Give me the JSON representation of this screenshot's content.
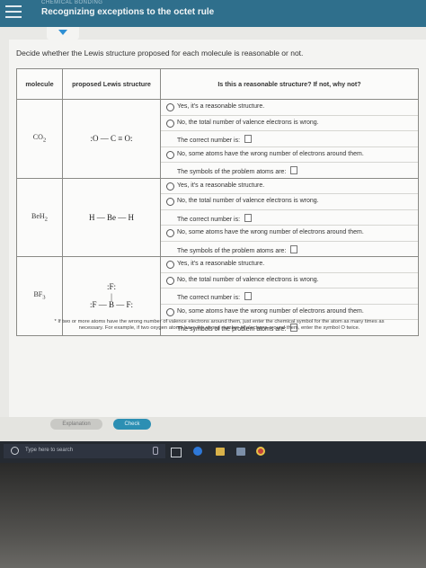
{
  "header": {
    "breadcrumb": "CHEMICAL BONDING",
    "title": "Recognizing exceptions to the octet rule"
  },
  "instruction": "Decide whether the Lewis structure proposed for each molecule is reasonable or not.",
  "table": {
    "headers": {
      "molecule": "molecule",
      "lewis": "proposed Lewis structure",
      "reasonable": "Is this a reasonable structure? If not, why not?"
    },
    "options": {
      "yes": "Yes, it's a reasonable structure.",
      "no_valence": "No, the total number of valence electrons is wrong.",
      "correct_number": "The correct number is:",
      "no_atoms": "No, some atoms have the wrong number of electrons around them.",
      "symbols": "The symbols of the problem atoms are:"
    },
    "rows": [
      {
        "molecule": "CO",
        "sub": "2",
        "lewis": ":O — C ≡ O:"
      },
      {
        "molecule": "BeH",
        "sub": "2",
        "lewis": "H — Be — H"
      },
      {
        "molecule": "BF",
        "sub": "3",
        "lewis": ":F — B — F:",
        "top_atom": ":F:"
      }
    ]
  },
  "footnote": "* If two or more atoms have the wrong number of valence electrons around them, just enter the chemical symbol for the atom as many times as necessary. For example, if two oxygen atoms have the wrong number of electrons around them, enter the symbol O twice.",
  "buttons": {
    "explanation": "Explanation",
    "check": "Check"
  },
  "taskbar": {
    "search_placeholder": "Type here to search"
  }
}
